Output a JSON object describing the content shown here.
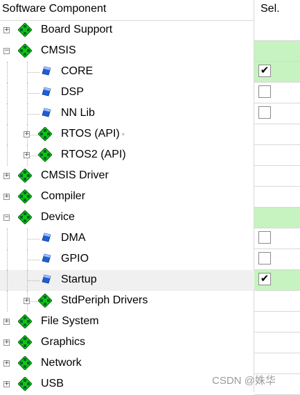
{
  "header": {
    "component": "Software Component",
    "sel": "Sel."
  },
  "rows": [
    {
      "label": "Board Support",
      "level": 0,
      "toggle": "+",
      "icon": "package-icon",
      "sel": "none"
    },
    {
      "label": "CMSIS",
      "level": 0,
      "toggle": "−",
      "icon": "package-icon",
      "sel": "green"
    },
    {
      "label": "CORE",
      "level": 1,
      "toggle": "",
      "icon": "component-icon",
      "sel": "checked"
    },
    {
      "label": "DSP",
      "level": 1,
      "toggle": "",
      "icon": "component-icon",
      "sel": "unchecked"
    },
    {
      "label": "NN Lib",
      "level": 1,
      "toggle": "",
      "icon": "component-icon",
      "sel": "unchecked"
    },
    {
      "label": "RTOS (API)",
      "level": 1,
      "toggle": "+",
      "icon": "package-icon",
      "sel": "none",
      "suffix": "◦"
    },
    {
      "label": "RTOS2 (API)",
      "level": 1,
      "toggle": "+",
      "icon": "package-icon",
      "sel": "none"
    },
    {
      "label": "CMSIS Driver",
      "level": 0,
      "toggle": "+",
      "icon": "package-icon",
      "sel": "none"
    },
    {
      "label": "Compiler",
      "level": 0,
      "toggle": "+",
      "icon": "package-icon",
      "sel": "none"
    },
    {
      "label": "Device",
      "level": 0,
      "toggle": "−",
      "icon": "package-icon",
      "sel": "green"
    },
    {
      "label": "DMA",
      "level": 1,
      "toggle": "",
      "icon": "component-icon",
      "sel": "unchecked"
    },
    {
      "label": "GPIO",
      "level": 1,
      "toggle": "",
      "icon": "component-icon",
      "sel": "unchecked"
    },
    {
      "label": "Startup",
      "level": 1,
      "toggle": "",
      "icon": "component-icon",
      "sel": "checked",
      "highlight": true
    },
    {
      "label": "StdPeriph Drivers",
      "level": 1,
      "toggle": "+",
      "icon": "package-icon",
      "sel": "none"
    },
    {
      "label": "File System",
      "level": 0,
      "toggle": "+",
      "icon": "package-icon",
      "sel": "none"
    },
    {
      "label": "Graphics",
      "level": 0,
      "toggle": "+",
      "icon": "package-icon",
      "sel": "none"
    },
    {
      "label": "Network",
      "level": 0,
      "toggle": "+",
      "icon": "package-icon",
      "sel": "none"
    },
    {
      "label": "USB",
      "level": 0,
      "toggle": "+",
      "icon": "package-icon",
      "sel": "none"
    }
  ],
  "checkmark": "✔",
  "watermark": "CSDN @姝华",
  "colors": {
    "selected_green": "#c6f3c0",
    "package_green": "#12c412",
    "component_blue": "#1f5fd6"
  }
}
